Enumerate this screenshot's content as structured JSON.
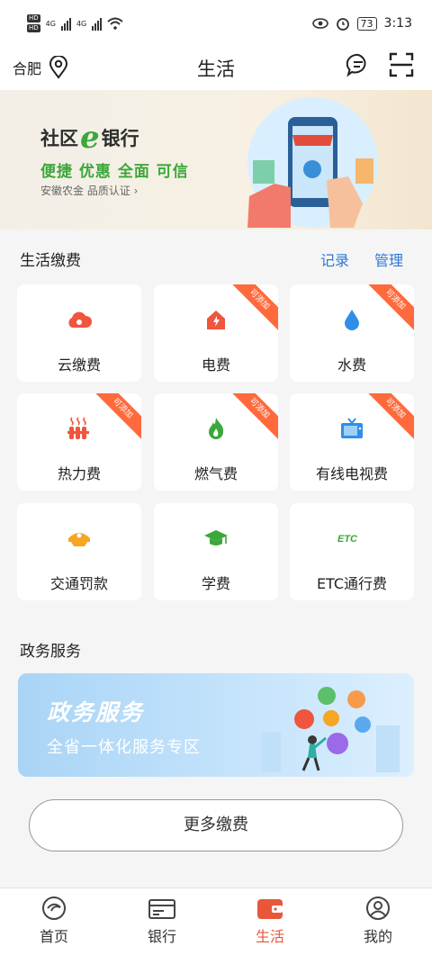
{
  "status_bar": {
    "time": "3:13",
    "battery": "73",
    "hd": "HD",
    "net1": "4G",
    "net2": "4G"
  },
  "header": {
    "city": "合肥",
    "title": "生活"
  },
  "banner": {
    "title_left": "社区",
    "title_e": "e",
    "title_right": "银行",
    "slogan": "便捷 优惠 全面 可信",
    "subtitle": "安徽农金 品质认证 ›"
  },
  "payments": {
    "title": "生活缴费",
    "record_label": "记录",
    "manage_label": "管理",
    "ribbon_text": "可添加",
    "items": [
      {
        "label": "云缴费",
        "icon": "cloud-pay-icon",
        "ribbon": false
      },
      {
        "label": "电费",
        "icon": "electricity-icon",
        "ribbon": true
      },
      {
        "label": "水费",
        "icon": "water-drop-icon",
        "ribbon": true
      },
      {
        "label": "热力费",
        "icon": "heating-icon",
        "ribbon": true
      },
      {
        "label": "燃气费",
        "icon": "gas-flame-icon",
        "ribbon": true
      },
      {
        "label": "有线电视费",
        "icon": "tv-icon",
        "ribbon": true
      },
      {
        "label": "交通罚款",
        "icon": "police-cap-icon",
        "ribbon": false
      },
      {
        "label": "学费",
        "icon": "graduation-cap-icon",
        "ribbon": false
      },
      {
        "label": "ETC通行费",
        "icon": "etc-icon",
        "ribbon": false
      }
    ]
  },
  "gov": {
    "section_title": "政务服务",
    "banner_title": "政务服务",
    "banner_subtitle": "全省一体化服务专区"
  },
  "more_button": "更多缴费",
  "tabs": [
    {
      "label": "首页",
      "icon": "home-icon",
      "active": false
    },
    {
      "label": "银行",
      "icon": "card-icon",
      "active": false
    },
    {
      "label": "生活",
      "icon": "wallet-icon",
      "active": true
    },
    {
      "label": "我的",
      "icon": "profile-icon",
      "active": false
    }
  ],
  "colors": {
    "accent": "#e8573a",
    "link": "#2f77d8",
    "ribbon": "#ff6a3c",
    "green": "#3aa83a"
  }
}
